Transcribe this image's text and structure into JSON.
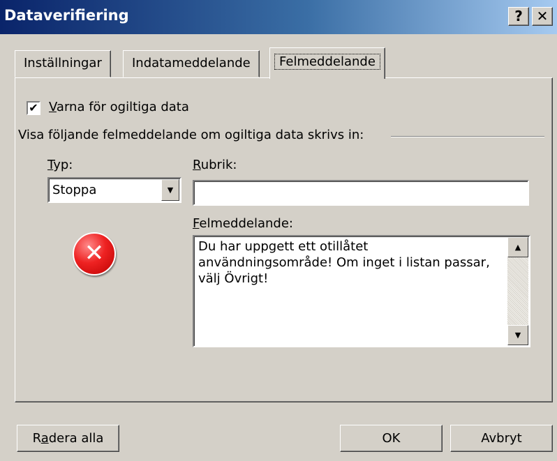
{
  "window": {
    "title": "Dataverifiering",
    "help_button": "?",
    "close_button": "✕"
  },
  "tabs": [
    {
      "label": "Inställningar",
      "active": false
    },
    {
      "label": "Indatameddelande",
      "active": false
    },
    {
      "label": "Felmeddelande",
      "active": true
    }
  ],
  "panel": {
    "checkbox": {
      "checked": true,
      "mark": "✔",
      "mnemonic": "V",
      "rest": "arna för ogiltiga data"
    },
    "group_label": "Visa följande felmeddelande om ogiltiga data skrivs in:",
    "type": {
      "mnemonic": "T",
      "rest": "yp:",
      "value": "Stoppa",
      "arrow": "▼"
    },
    "rubrik": {
      "mnemonic": "R",
      "rest": "ubrik:",
      "value": ""
    },
    "message": {
      "mnemonic": "F",
      "rest": "elmeddelande:",
      "value": "Du har uppgett ett otillåtet användningsområde! Om inget i listan passar, välj Övrigt!",
      "scroll_up": "▲",
      "scroll_down": "▼"
    },
    "icon_glyph": "✕"
  },
  "buttons": {
    "clear": {
      "before": "R",
      "mnemonic": "a",
      "after": "dera alla"
    },
    "ok": "OK",
    "cancel": "Avbryt"
  },
  "colors": {
    "title_gradient_start": "#0a246a",
    "title_gradient_end": "#a6caf0",
    "dialog_face": "#d4d0c8",
    "error_icon": "#e22222"
  }
}
